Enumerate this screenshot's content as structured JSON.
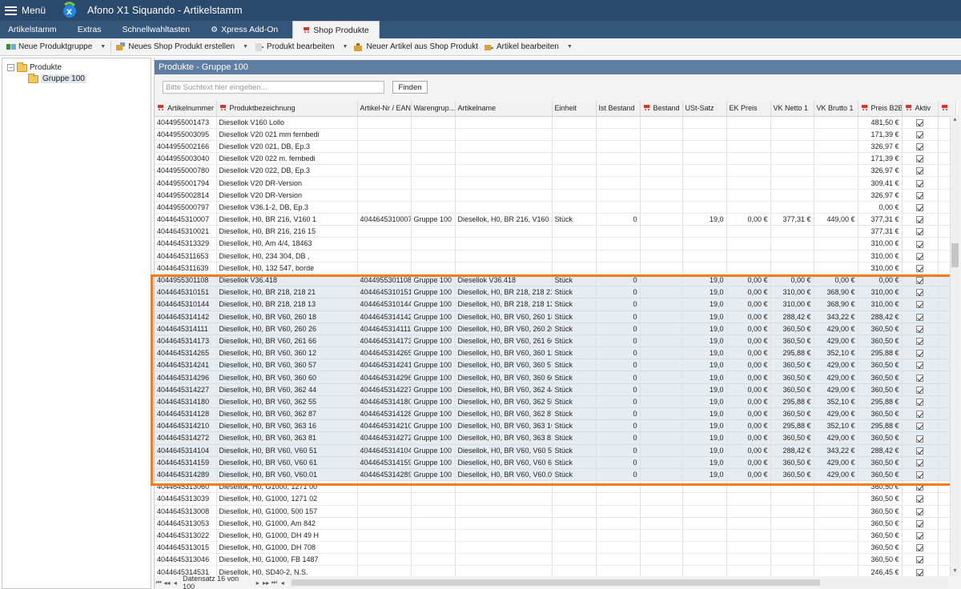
{
  "titlebar": {
    "menu_label": "Menü",
    "app_title": "Afono X1 Siquando - Artikelstamm"
  },
  "tabs": [
    {
      "label": "Artikelstamm",
      "active": false
    },
    {
      "label": "Extras",
      "active": false
    },
    {
      "label": "Schnellwahltasten",
      "active": false
    },
    {
      "label": "Xpress Add-On",
      "active": false
    },
    {
      "label": "Shop Produkte",
      "active": true
    }
  ],
  "toolbar": {
    "new_group": "Neue Produktgruppe",
    "new_product": "Neues Shop Produkt erstellen",
    "edit_product": "Produkt bearbeiten",
    "new_article": "Neuer Artikel aus Shop Produkt",
    "edit_article": "Artikel bearbeiten"
  },
  "tree": {
    "root": "Produkte",
    "child": "Gruppe 100"
  },
  "panel": {
    "title": "Produkte - Gruppe 100",
    "search_placeholder": "Bitte Suchtext hier eingeben...",
    "find_label": "Finden"
  },
  "grid": {
    "columns": [
      "Artikelnummer",
      "Produktbezeichnung",
      "Artikel-Nr / EAN",
      "Warengrup...",
      "Artikelname",
      "Einheit",
      "Ist Bestand",
      "Bestand",
      "USt-Satz",
      "EK Preis",
      "VK Netto 1",
      "VK Brutto 1",
      "Preis B2B",
      "Aktiv",
      ""
    ],
    "rows": [
      [
        "4044955001473",
        "Diesellok V160 Lollo",
        "",
        "",
        "",
        "",
        "",
        "",
        "",
        "",
        "",
        "",
        "481,50 €",
        true
      ],
      [
        "4044955003095",
        "Diesellok V20 021 mm fernbedi",
        "",
        "",
        "",
        "",
        "",
        "",
        "",
        "",
        "",
        "",
        "171,39 €",
        true
      ],
      [
        "4044955002166",
        "Diesellok V20 021, DB, Ep.3",
        "",
        "",
        "",
        "",
        "",
        "",
        "",
        "",
        "",
        "",
        "326,97 €",
        true
      ],
      [
        "4044955003040",
        "Diesellok V20 022 m. fernbedi",
        "",
        "",
        "",
        "",
        "",
        "",
        "",
        "",
        "",
        "",
        "171,39 €",
        true
      ],
      [
        "4044955000780",
        "Diesellok V20 022, DB, Ep.3",
        "",
        "",
        "",
        "",
        "",
        "",
        "",
        "",
        "",
        "",
        "326,97 €",
        true
      ],
      [
        "4044955001794",
        "Diesellok V20 DR-Version",
        "",
        "",
        "",
        "",
        "",
        "",
        "",
        "",
        "",
        "",
        "309,41 €",
        true
      ],
      [
        "4044955002814",
        "Diesellok V20 DR-Version",
        "",
        "",
        "",
        "",
        "",
        "",
        "",
        "",
        "",
        "",
        "326,97 €",
        true
      ],
      [
        "4044955000797",
        "Diesellok V36.1-2, DB, Ep.3",
        "",
        "",
        "",
        "",
        "",
        "",
        "",
        "",
        "",
        "",
        "0,00 €",
        true
      ],
      [
        "4044645310007",
        "Diesellok, H0, BR 216, V160 1",
        "4044645310007",
        "Gruppe 100",
        "Diesellok, H0, BR 216, V160 1",
        "Stück",
        "0",
        "",
        "19,0",
        "0,00 €",
        "377,31 €",
        "449,00 €",
        "377,31 €",
        true
      ],
      [
        "4044645310021",
        "Diesellok, H0, BR 216, 216 15",
        "",
        "",
        "",
        "",
        "",
        "",
        "",
        "",
        "",
        "",
        "377,31 €",
        true
      ],
      [
        "4044645313329",
        "Diesellok, H0, Am 4/4, 18463",
        "",
        "",
        "",
        "",
        "",
        "",
        "",
        "",
        "",
        "",
        "310,00 €",
        true
      ],
      [
        "4044645311653",
        "Diesellok, H0, 234 304, DB ,",
        "",
        "",
        "",
        "",
        "",
        "",
        "",
        "",
        "",
        "",
        "310,00 €",
        true
      ],
      [
        "4044645311639",
        "Diesellok, H0, 132 547, borde",
        "",
        "",
        "",
        "",
        "",
        "",
        "",
        "",
        "",
        "",
        "310,00 €",
        true
      ],
      [
        "4044955301108",
        "Diesellok V36.418",
        "4044955301108",
        "Gruppe 100",
        "Diesellok V36.418",
        "Stück",
        "0",
        "",
        "19,0",
        "0,00 €",
        "0,00 €",
        "0,00 €",
        "0,00 €",
        true,
        "hl"
      ],
      [
        "4044645310151",
        "Diesellok, H0, BR 218, 218 21",
        "4044645310151",
        "Gruppe 100",
        "Diesellok, H0, BR 218, 218 21",
        "Stück",
        "0",
        "",
        "19,0",
        "0,00 €",
        "310,00 €",
        "368,90 €",
        "310,00 €",
        true,
        "hl"
      ],
      [
        "4044645310144",
        "Diesellok, H0, BR 218, 218 13",
        "4044645310144",
        "Gruppe 100",
        "Diesellok, H0, BR 218, 218 13",
        "Stück",
        "0",
        "",
        "19,0",
        "0,00 €",
        "310,00 €",
        "368,90 €",
        "310,00 €",
        true,
        "hl"
      ],
      [
        "4044645314142",
        "Diesellok, H0, BR V60, 260 18",
        "4044645314142",
        "Gruppe 100",
        "Diesellok, H0, BR V60, 260 18",
        "Stück",
        "0",
        "",
        "19,0",
        "0,00 €",
        "288,42 €",
        "343,22 €",
        "288,42 €",
        true,
        "hl"
      ],
      [
        "4044645314111",
        "Diesellok, H0, BR V60, 260 26",
        "4044645314111",
        "Gruppe 100",
        "Diesellok, H0, BR V60, 260 26",
        "Stück",
        "0",
        "",
        "19,0",
        "0,00 €",
        "360,50 €",
        "429,00 €",
        "360,50 €",
        true,
        "hl"
      ],
      [
        "4044645314173",
        "Diesellok, H0, BR V60, 261 66",
        "4044645314173",
        "Gruppe 100",
        "Diesellok, H0, BR V60, 261 66",
        "Stück",
        "0",
        "",
        "19,0",
        "0,00 €",
        "360,50 €",
        "429,00 €",
        "360,50 €",
        true,
        "hl"
      ],
      [
        "4044645314265",
        "Diesellok, H0, BR V60, 360 12",
        "4044645314265",
        "Gruppe 100",
        "Diesellok, H0, BR V60, 360 12",
        "Stück",
        "0",
        "",
        "19,0",
        "0,00 €",
        "295,88 €",
        "352,10 €",
        "295,88 €",
        true,
        "hl"
      ],
      [
        "4044645314241",
        "Diesellok, H0, BR V60, 360 57",
        "4044645314241",
        "Gruppe 100",
        "Diesellok, H0, BR V60, 360 57",
        "Stück",
        "0",
        "",
        "19,0",
        "0,00 €",
        "360,50 €",
        "429,00 €",
        "360,50 €",
        true,
        "hl"
      ],
      [
        "4044645314296",
        "Diesellok, H0, BR V60, 360 60",
        "4044645314296",
        "Gruppe 100",
        "Diesellok, H0, BR V60, 360 60",
        "Stück",
        "0",
        "",
        "19,0",
        "0,00 €",
        "360,50 €",
        "429,00 €",
        "360,50 €",
        true,
        "hl"
      ],
      [
        "4044645314227",
        "Diesellok, H0, BR V60, 362 44",
        "4044645314227",
        "Gruppe 100",
        "Diesellok, H0, BR V60, 362 44",
        "Stück",
        "0",
        "",
        "19,0",
        "0,00 €",
        "360,50 €",
        "429,00 €",
        "360,50 €",
        true,
        "hl"
      ],
      [
        "4044645314180",
        "Diesellok, H0, BR V60, 362 55",
        "4044645314180",
        "Gruppe 100",
        "Diesellok, H0, BR V60, 362 55",
        "Stück",
        "0",
        "",
        "19,0",
        "0,00 €",
        "295,88 €",
        "352,10 €",
        "295,88 €",
        true,
        "hl"
      ],
      [
        "4044645314128",
        "Diesellok, H0, BR V60, 362 87",
        "4044645314128",
        "Gruppe 100",
        "Diesellok, H0, BR V60, 362 87",
        "Stück",
        "0",
        "",
        "19,0",
        "0,00 €",
        "360,50 €",
        "429,00 €",
        "360,50 €",
        true,
        "hl"
      ],
      [
        "4044645314210",
        "Diesellok, H0, BR V60, 363 16",
        "4044645314210",
        "Gruppe 100",
        "Diesellok, H0, BR V60, 363 16",
        "Stück",
        "0",
        "",
        "19,0",
        "0,00 €",
        "295,88 €",
        "352,10 €",
        "295,88 €",
        true,
        "hl"
      ],
      [
        "4044645314272",
        "Diesellok, H0, BR V60, 363 81",
        "4044645314272",
        "Gruppe 100",
        "Diesellok, H0, BR V60, 363 81",
        "Stück",
        "0",
        "",
        "19,0",
        "0,00 €",
        "360,50 €",
        "429,00 €",
        "360,50 €",
        true,
        "hl"
      ],
      [
        "4044645314104",
        "Diesellok, H0, BR V60, V60 51",
        "4044645314104",
        "Gruppe 100",
        "Diesellok, H0, BR V60, V60 51",
        "Stück",
        "0",
        "",
        "19,0",
        "0,00 €",
        "288,42 €",
        "343,22 €",
        "288,42 €",
        true,
        "hl"
      ],
      [
        "4044645314159",
        "Diesellok, H0, BR V60, V60 61",
        "4044645314159",
        "Gruppe 100",
        "Diesellok, H0, BR V60, V60 61",
        "Stück",
        "0",
        "",
        "19,0",
        "0,00 €",
        "360,50 €",
        "429,00 €",
        "360,50 €",
        true,
        "hl"
      ],
      [
        "4044645314289",
        "Diesellok, H0, BR V60, V60.01",
        "4044645314289",
        "Gruppe 100",
        "Diesellok, H0, BR V60, V60.01",
        "Stück",
        "0",
        "",
        "19,0",
        "0,00 €",
        "360,50 €",
        "429,00 €",
        "360,50 €",
        true,
        "hl"
      ],
      [
        "4044645313060",
        "Diesellok, H0, G1000, 1271 00",
        "",
        "",
        "",
        "",
        "",
        "",
        "",
        "",
        "",
        "",
        "360,50 €",
        true
      ],
      [
        "4044645313039",
        "Diesellok, H0, G1000, 1271 02",
        "",
        "",
        "",
        "",
        "",
        "",
        "",
        "",
        "",
        "",
        "360,50 €",
        true
      ],
      [
        "4044645313008",
        "Diesellok, H0, G1000, 500 157",
        "",
        "",
        "",
        "",
        "",
        "",
        "",
        "",
        "",
        "",
        "360,50 €",
        true
      ],
      [
        "4044645313053",
        "Diesellok, H0, G1000, Am 842",
        "",
        "",
        "",
        "",
        "",
        "",
        "",
        "",
        "",
        "",
        "360,50 €",
        true
      ],
      [
        "4044645313022",
        "Diesellok, H0, G1000, DH 49 H",
        "",
        "",
        "",
        "",
        "",
        "",
        "",
        "",
        "",
        "",
        "360,50 €",
        true
      ],
      [
        "4044645313015",
        "Diesellok, H0, G1000, DH 708",
        "",
        "",
        "",
        "",
        "",
        "",
        "",
        "",
        "",
        "",
        "360,50 €",
        true
      ],
      [
        "4044645313046",
        "Diesellok, H0, G1000, FB 1487",
        "",
        "",
        "",
        "",
        "",
        "",
        "",
        "",
        "",
        "",
        "360,50 €",
        true
      ],
      [
        "4044645314531",
        "Diesellok, H0, SD40-2, N.S.",
        "",
        "",
        "",
        "",
        "",
        "",
        "",
        "",
        "",
        "",
        "246,45 €",
        true
      ]
    ]
  },
  "status": {
    "record_text": "Datensatz 16 von 100"
  },
  "colors": {
    "titlebar": "#2b4a6b",
    "tabsbar": "#34567a",
    "panel_header": "#5f7ea1",
    "highlight_border": "#f47b20",
    "cart_icon": "#d8342b"
  }
}
